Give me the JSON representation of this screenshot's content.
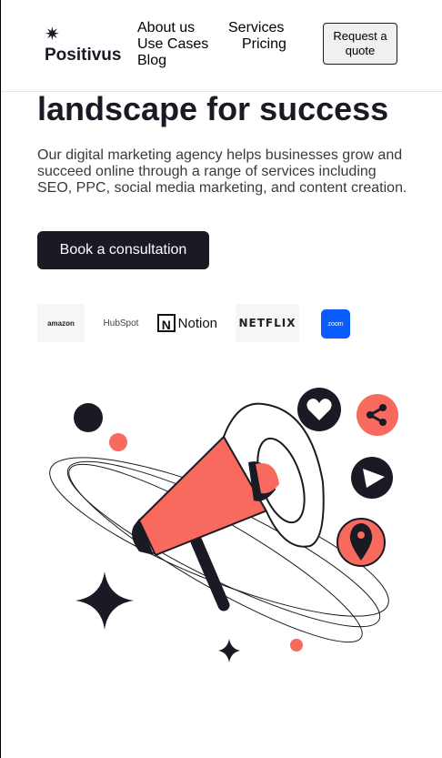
{
  "brand": {
    "name": "Positivus",
    "logo_icon": "asterisk-star-icon"
  },
  "nav": {
    "items": [
      "About us",
      "Services",
      "Use Cases",
      "Pricing",
      "Blog"
    ]
  },
  "header": {
    "quote_button": "Request a quote"
  },
  "hero": {
    "title_visible": "landscape for success",
    "description": "Our digital marketing agency helps businesses grow and succeed online through a range of services including SEO, PPC, social media marketing, and content creation.",
    "cta": "Book a consultation"
  },
  "clients": [
    "amazon",
    "HubSpot",
    "Notion",
    "NETFLIX",
    "zoom"
  ],
  "illustration": {
    "icons": [
      "megaphone-icon",
      "heart-icon",
      "share-icon",
      "play-icon",
      "location-pin-icon",
      "sparkle-star-icon"
    ],
    "colors": {
      "accent": "#f8695e",
      "dark": "#191a23"
    }
  }
}
